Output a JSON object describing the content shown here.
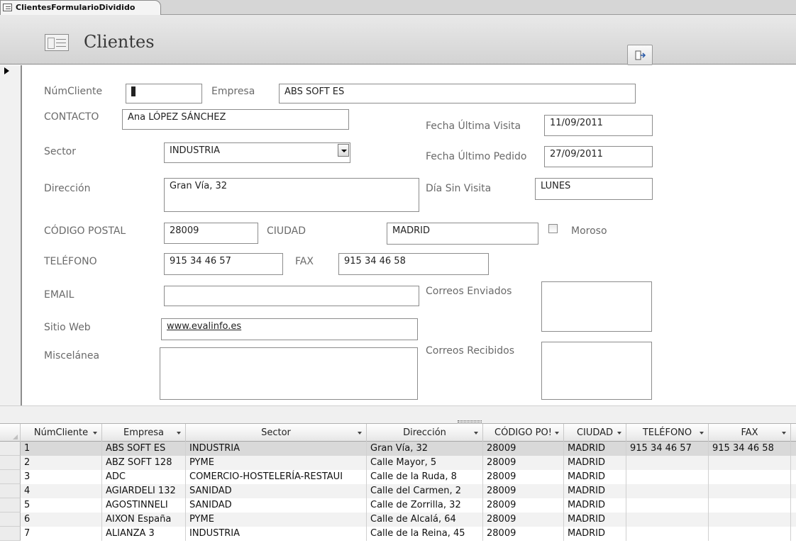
{
  "tab": {
    "label": "ClientesFormularioDividido"
  },
  "header": {
    "title": "Clientes",
    "close_icon": "exit-form-icon"
  },
  "form": {
    "numcliente": {
      "label": "NúmCliente",
      "value": "1"
    },
    "empresa": {
      "label": "Empresa",
      "value": "ABS SOFT ES"
    },
    "contacto": {
      "label": "CONTACTO",
      "value": "Ana LÓPEZ SÁNCHEZ"
    },
    "fecha_ultima_visita": {
      "label": "Fecha Última Visita",
      "value": "11/09/2011"
    },
    "sector": {
      "label": "Sector",
      "value": "INDUSTRIA"
    },
    "fecha_ultimo_pedido": {
      "label": "Fecha Último Pedido",
      "value": "27/09/2011"
    },
    "direccion": {
      "label": "Dirección",
      "value": "Gran Vía, 32"
    },
    "dia_sin_visita": {
      "label": "Día Sin Visita",
      "value": "LUNES"
    },
    "codigo_postal": {
      "label": "CÓDIGO POSTAL",
      "value": "28009"
    },
    "ciudad": {
      "label": "CIUDAD",
      "value": "MADRID"
    },
    "moroso": {
      "label": "Moroso",
      "checked": false
    },
    "telefono": {
      "label": "TELÉFONO",
      "value": "915 34 46 57"
    },
    "fax": {
      "label": "FAX",
      "value": "915 34 46 58"
    },
    "email": {
      "label": "EMAIL",
      "value": ""
    },
    "correos_enviados": {
      "label": "Correos Enviados",
      "value": ""
    },
    "sitio_web": {
      "label": "Sitio Web",
      "value": "www.evalinfo.es"
    },
    "miscelanea": {
      "label": "Miscelánea",
      "value": ""
    },
    "correos_recibidos": {
      "label": "Correos Recibidos",
      "value": ""
    }
  },
  "datasheet": {
    "columns": [
      "NúmCliente",
      "Empresa",
      "Sector",
      "Dirección",
      "CÓDIGO PO!",
      "CIUDAD",
      "TELÉFONO",
      "FAX"
    ],
    "rows": [
      [
        "1",
        "ABS SOFT ES",
        "INDUSTRIA",
        "Gran Vía, 32",
        "28009",
        "MADRID",
        "915 34 46 57",
        "915 34 46 58"
      ],
      [
        "2",
        "ABZ SOFT 128",
        "PYME",
        "Calle Mayor, 5",
        "28009",
        "MADRID",
        "",
        ""
      ],
      [
        "3",
        "ADC",
        "COMERCIO-HOSTELERÍA-RESTAUI",
        "Calle de la Ruda, 8",
        "28009",
        "MADRID",
        "",
        ""
      ],
      [
        "4",
        "AGIARDELI 132",
        "SANIDAD",
        "Calle del Carmen, 2",
        "28009",
        "MADRID",
        "",
        ""
      ],
      [
        "5",
        "AGOSTINNELI",
        "SANIDAD",
        "Calle de Zorrilla, 32",
        "28009",
        "MADRID",
        "",
        ""
      ],
      [
        "6",
        "AIXON España",
        "PYME",
        "Calle de Alcalá, 64",
        "28009",
        "MADRID",
        "",
        ""
      ],
      [
        "7",
        "ALIANZA 3",
        "INDUSTRIA",
        "Calle de la Reina, 45",
        "28009",
        "MADRID",
        "",
        ""
      ]
    ]
  }
}
